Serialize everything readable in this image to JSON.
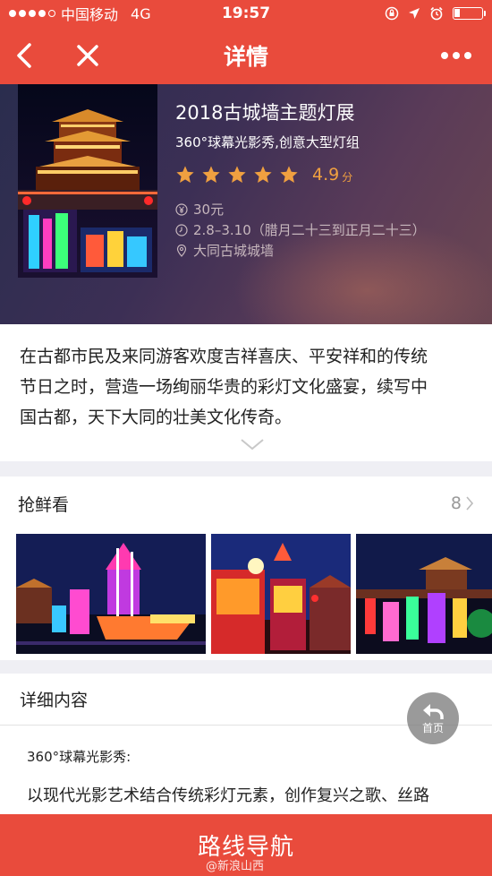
{
  "status_bar": {
    "carrier": "中国移动",
    "network": "4G",
    "time": "19:57"
  },
  "nav": {
    "title": "详情",
    "icons": [
      "back-icon",
      "close-icon",
      "more-icon"
    ]
  },
  "event": {
    "title": "2018古城墙主题灯展",
    "subtitle": "360°球幕光影秀,创意大型灯组",
    "stars": 5,
    "rating": "4.9",
    "rating_unit": "分",
    "price": "30元",
    "date": "2.8–3.10（腊月二十三到正月二十三）",
    "location": "大同古城城墙",
    "accent_color": "#f0a040"
  },
  "description": {
    "lines": [
      "在古都市民及来同游客欢度吉祥喜庆、平安祥和的传统",
      "节日之时，营造一场绚丽华贵的彩灯文化盛宴，续写中",
      "国古都，天下大同的壮美文化传奇。"
    ]
  },
  "photos": {
    "title": "抢鲜看",
    "count": "8"
  },
  "details": {
    "title": "详细内容",
    "subheading": "360°球幕光影秀:",
    "body": "以现代光影艺术结合传统彩灯元素，创作复兴之歌、丝路"
  },
  "home_button": {
    "label": "首页"
  },
  "bottom_button": {
    "label": "路线导航",
    "color": "#e94b3c"
  },
  "watermark": "@新浪山西"
}
